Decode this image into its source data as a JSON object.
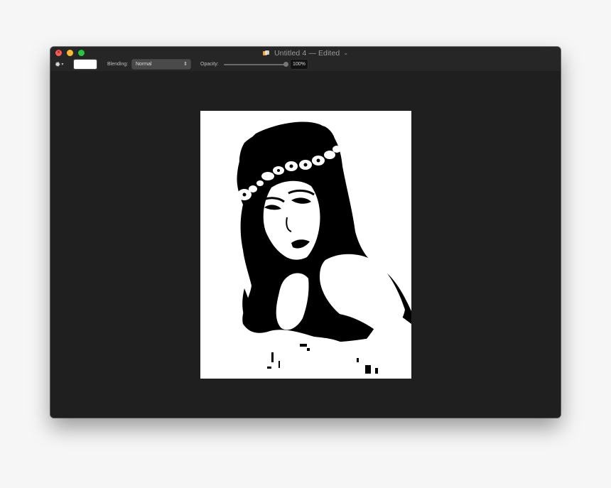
{
  "window": {
    "title": "Untitled 4 — Edited",
    "title_chevron": "chevron-down-icon",
    "doc_icon": "document-icon"
  },
  "traffic_lights": {
    "close_color": "#fe5f57",
    "minimize_color": "#febc2e",
    "maximize_color": "#28c840"
  },
  "toolbar": {
    "gear_icon": "gear-icon",
    "color_swatch": "#ffffff",
    "blending_label": "Blending:",
    "blending_value": "Normal",
    "opacity_label": "Opacity:",
    "opacity_value": "100%",
    "opacity_level": 1.0
  },
  "canvas": {
    "background": "#1f1f1f",
    "artboard_background": "#ffffff",
    "image": "black-and-white portrait of a woman with flower crown"
  }
}
